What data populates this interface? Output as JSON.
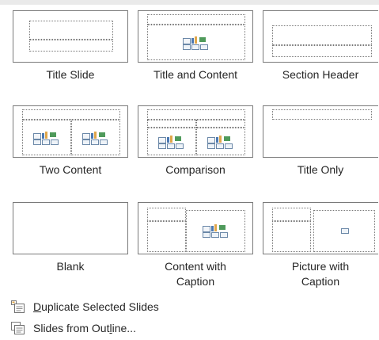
{
  "layouts": [
    {
      "name": "Title Slide"
    },
    {
      "name": "Title and Content"
    },
    {
      "name": "Section Header"
    },
    {
      "name": "Two Content"
    },
    {
      "name": "Comparison"
    },
    {
      "name": "Title Only"
    },
    {
      "name": "Blank"
    },
    {
      "name": "Content with Caption",
      "line1": "Content with",
      "line2": "Caption"
    },
    {
      "name": "Picture with Caption",
      "line1": "Picture with",
      "line2": "Caption"
    }
  ],
  "commands": {
    "duplicate": {
      "pre": "",
      "key": "D",
      "post": "uplicate Selected Slides",
      "icon": "duplicate-slides-icon"
    },
    "outline": {
      "pre": "Slides from Out",
      "key": "l",
      "post": "ine...",
      "icon": "slides-outline-icon"
    }
  },
  "colors": {
    "border": "#7a7a7a",
    "placeholder": "#777777",
    "text": "#262626",
    "chart_orange": "#e0a64a",
    "chart_blue": "#4b78b0",
    "chart_green": "#4f9a5b"
  }
}
